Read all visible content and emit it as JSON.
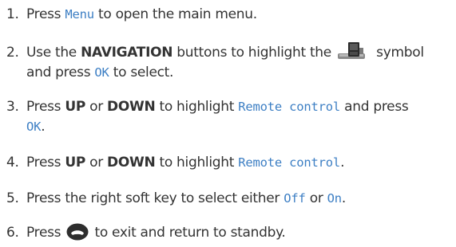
{
  "steps": [
    {
      "num": "1.",
      "t1": "Press ",
      "menu": "Menu",
      "t2": " to open the main menu."
    },
    {
      "num": "2.",
      "t1": "Use the ",
      "nav": "NAVIGATION",
      "t2": " buttons to highlight the ",
      "t3": " symbol",
      "line2a": "and press ",
      "ok": "OK",
      "line2b": " to select.",
      "icon": "settings-symbol-icon"
    },
    {
      "num": "3.",
      "t1": "Press ",
      "up": "UP",
      "or": " or ",
      "down": "DOWN",
      "t2": " to highlight ",
      "rc": "Remote control",
      "t3": " and press",
      "ok": "OK",
      "dot": "."
    },
    {
      "num": "4.",
      "t1": "Press ",
      "up": "UP",
      "or": " or ",
      "down": "DOWN",
      "t2": " to highlight ",
      "rc": "Remote control",
      "dot": "."
    },
    {
      "num": "5.",
      "t1": "Press the right soft key to select either ",
      "off": "Off",
      "or": " or ",
      "on": "On",
      "dot": "."
    },
    {
      "num": "6.",
      "t1": "Press ",
      "t2": " to exit and return to standby.",
      "icon": "end-call-key-icon"
    }
  ],
  "colors": {
    "text": "#333333",
    "screen_text": "#3d7fc4"
  }
}
